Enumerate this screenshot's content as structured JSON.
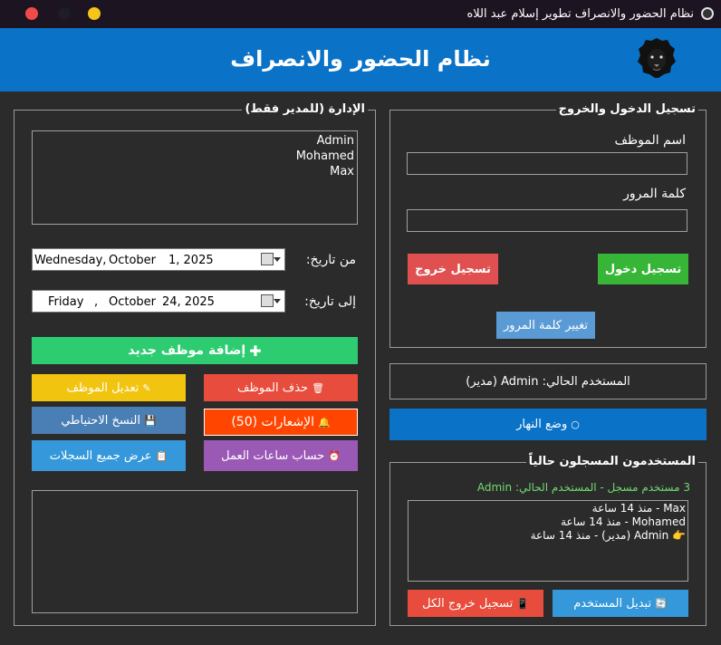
{
  "window": {
    "title": "نظام الحضور والانصراف تطوير إسلام عبد اللاه"
  },
  "header": {
    "title": "نظام الحضور والانصراف"
  },
  "admin": {
    "group_title": "الإدارة (للمدير فقط)",
    "employees": [
      "Admin",
      "Mohamed",
      "Max"
    ],
    "from_label": "من تاريخ:",
    "from_date": {
      "day": "Wednesday,",
      "month": "October",
      "date": "1, 2025"
    },
    "to_label": "إلى تاريخ:",
    "to_date": {
      "day": "Friday",
      "sep": ",",
      "month": "October",
      "date": "24, 2025"
    },
    "add_employee": "إضافة موظف جديد",
    "add_icon": "✚",
    "delete_employee": "حذف الموظف",
    "delete_icon": "🗑",
    "edit_employee": "تعديل الموظف",
    "edit_icon": "✎",
    "notifications": "الإشعارات (50)",
    "notifications_icon": "🔔",
    "backup": "النسخ الاحتياطي",
    "backup_icon": "💾",
    "work_hours": "حساب ساعات العمل",
    "work_hours_icon": "⏰",
    "all_records": "عرض جميع السجلات",
    "all_records_icon": "📋"
  },
  "login": {
    "group_title": "تسجيل الدخول والخروج",
    "username_label": "اسم الموظف",
    "password_label": "كلمة المرور",
    "checkin": "تسجيل دخول",
    "checkout": "تسجيل خروج",
    "change_password": "تغيير كلمة المرور"
  },
  "current_user": {
    "text": "المستخدم الحالي: Admin (مدير)"
  },
  "day_mode": {
    "label": "وضع النهار",
    "icon": "○"
  },
  "logged_in": {
    "group_title": "المستخدمون المسجلون حالياً",
    "status": "3 مستخدم مسجل - المستخدم الحالي: Admin",
    "users": [
      "Max - منذ 14 ساعة",
      "Mohamed - منذ 14 ساعة",
      "👉 Admin (مدير) - منذ 14 ساعة"
    ],
    "switch_user": "تبديل المستخدم",
    "switch_icon": "🔄",
    "logout_all": "تسجيل خروج الكل",
    "logout_all_icon": "📱"
  },
  "colors": {
    "header_blue": "#0a72c7",
    "green": "#2ecc71",
    "red": "#e74c3c",
    "yellow": "#f1c40f",
    "steel_blue": "#4a7fb5",
    "orange_red": "#ff4500",
    "blue": "#3498db",
    "purple": "#9b59b6",
    "login_green": "#37b537",
    "login_red": "#e05050",
    "light_blue": "#5b9bd5"
  }
}
